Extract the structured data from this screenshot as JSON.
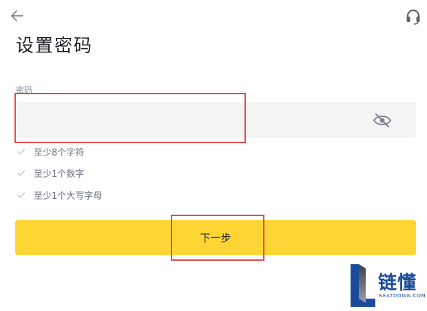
{
  "header": {
    "back_icon": "arrow-left-icon",
    "support_icon": "headset-icon",
    "title": "设置密码"
  },
  "password_field": {
    "label": "密码",
    "value": "",
    "placeholder": "",
    "visibility_icon": "eye-off-icon"
  },
  "rules": [
    {
      "icon": "check-icon",
      "text": "至少8个字符"
    },
    {
      "icon": "check-icon",
      "text": "至少1个数字"
    },
    {
      "icon": "check-icon",
      "text": "至少1个大写字母"
    }
  ],
  "next_button": {
    "label": "下一步"
  },
  "annotations": {
    "highlight_color": "#df4848"
  },
  "watermark": {
    "title": "链懂",
    "subtitle": "NEATDOWN.COM"
  },
  "colors": {
    "accent": "#fcd535",
    "input_bg": "#f4f4f5",
    "title_text": "#1f2126",
    "muted_text": "#8a8e96",
    "watermark_blue": "#1a4a9e"
  }
}
